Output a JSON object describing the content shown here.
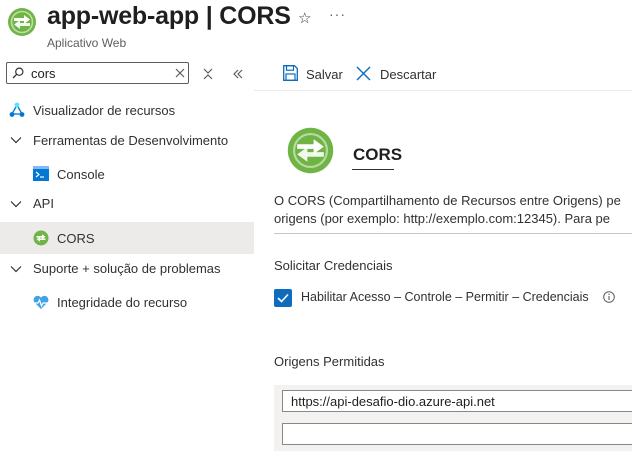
{
  "header": {
    "title": "app-web-app | CORS",
    "subtitle": "Aplicativo Web",
    "star_icon": "☆",
    "more_icon": "···"
  },
  "sidebar": {
    "search": {
      "value": "cors",
      "placeholder": ""
    },
    "items": [
      {
        "label": "Visualizador de recursos"
      },
      {
        "label": "Ferramentas de Desenvolvimento"
      },
      {
        "label": "Console"
      },
      {
        "label": "API"
      },
      {
        "label": "CORS",
        "selected": true
      },
      {
        "label": "Suporte + solução de problemas"
      },
      {
        "label": "Integridade do recurso"
      }
    ]
  },
  "toolbar": {
    "save_label": "Salvar",
    "discard_label": "Descartar"
  },
  "main": {
    "heading": "CORS",
    "description_line1": "O CORS (Compartilhamento de Recursos entre Origens) pe",
    "description_line2": "origens (por exemplo: http://exemplo.com:12345). Para pe",
    "credentials_heading": "Solicitar Credenciais",
    "credentials_checkbox_label": "Habilitar Acesso – Controle – Permitir – Credenciais",
    "credentials_checked": true,
    "origins_heading": "Origens Permitidas",
    "origins": [
      "https://api-desafio-dio.azure-api.net",
      ""
    ]
  },
  "colors": {
    "accent": "#0f6cbd",
    "icon_green": "#5ea43b",
    "selected_bg": "#edebe9"
  }
}
